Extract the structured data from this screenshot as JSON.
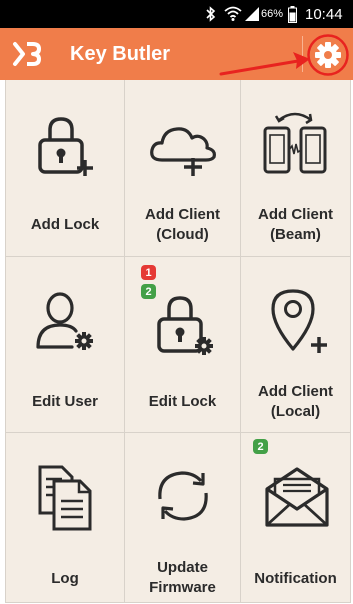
{
  "status_bar": {
    "battery_percent": "66%",
    "time": "10:44",
    "icons": [
      "bluetooth-icon",
      "wifi-icon",
      "signal-icon",
      "battery-icon"
    ]
  },
  "app_bar": {
    "title": "Key Butler",
    "logo_icon": "key-butler-logo-icon",
    "settings_icon": "gear-icon"
  },
  "tiles": [
    {
      "label_lines": [
        "Add Lock"
      ],
      "icon": "add-lock-icon"
    },
    {
      "label_lines": [
        "Add Client",
        "(Cloud)"
      ],
      "icon": "add-client-cloud-icon"
    },
    {
      "label_lines": [
        "Add Client",
        "(Beam)"
      ],
      "icon": "add-client-beam-icon"
    },
    {
      "label_lines": [
        "Edit User"
      ],
      "icon": "edit-user-icon"
    },
    {
      "label_lines": [
        "Edit Lock"
      ],
      "icon": "edit-lock-icon",
      "badges": [
        "1",
        "2"
      ]
    },
    {
      "label_lines": [
        "Add Client",
        "(Local)"
      ],
      "icon": "add-client-local-icon"
    },
    {
      "label_lines": [
        "Log"
      ],
      "icon": "log-icon"
    },
    {
      "label_lines": [
        "Update",
        "Firmware"
      ],
      "icon": "update-firmware-icon"
    },
    {
      "label_lines": [
        "Notification"
      ],
      "icon": "notification-icon",
      "badges": [
        "2"
      ]
    }
  ],
  "colors": {
    "app_bar": "#f07d4a",
    "grid_background": "#f4ede4",
    "badge_red": "#e53935",
    "badge_green": "#43a047",
    "annotation_red": "#e8231f"
  }
}
